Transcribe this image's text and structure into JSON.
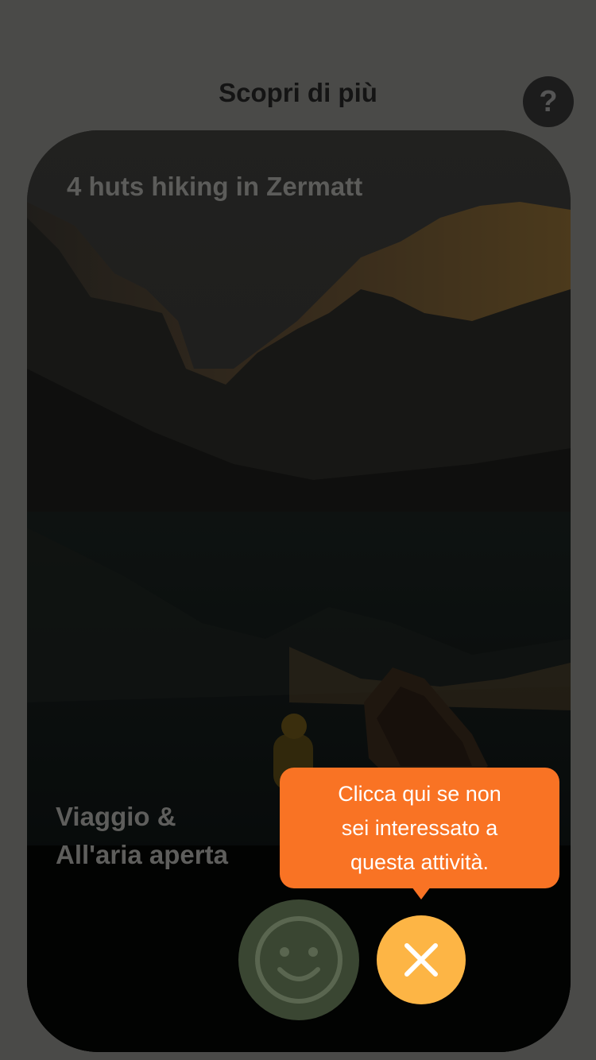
{
  "header": {
    "title": "Scopri di più",
    "help_label": "?"
  },
  "card": {
    "title": "4 huts hiking in Zermatt",
    "tags": [
      "Viaggio &",
      "All'aria aperta"
    ],
    "image_subject": "mountain lake with rowing boat"
  },
  "actions": {
    "like_icon": "smiley-face-icon",
    "dismiss_icon": "close-icon"
  },
  "tooltip": {
    "lines": [
      "Clicca qui se non",
      "sei interessato a",
      "questa attività."
    ]
  },
  "colors": {
    "overlay": "#4a4a48",
    "tooltip": "#f97324",
    "dismiss_button": "#fdb545",
    "like_button": "#3a4632"
  }
}
